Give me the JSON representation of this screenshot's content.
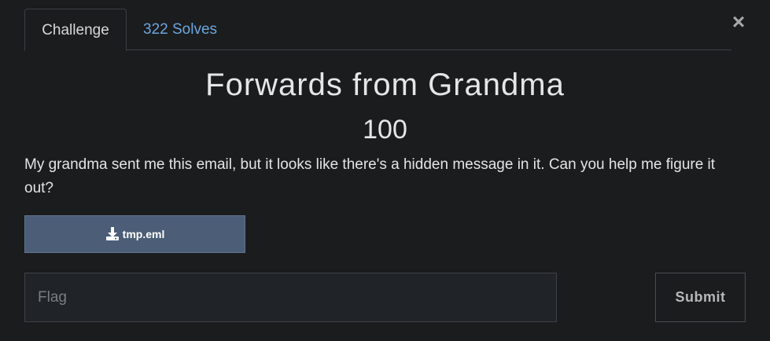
{
  "close_icon": "×",
  "tabs": {
    "challenge_label": "Challenge",
    "solves_label": "322 Solves"
  },
  "challenge": {
    "title": "Forwards from Grandma",
    "points": "100",
    "description": "My grandma sent me this email, but it looks like there's a hidden message in it. Can you help me figure it out?"
  },
  "file": {
    "icon": "download-icon",
    "name": "tmp.eml"
  },
  "flag": {
    "placeholder": "Flag",
    "value": ""
  },
  "submit": {
    "label": "Submit"
  },
  "colors": {
    "background": "#1b1c1e",
    "accent_link": "#6ca7dd",
    "file_button": "#4b5d77"
  }
}
